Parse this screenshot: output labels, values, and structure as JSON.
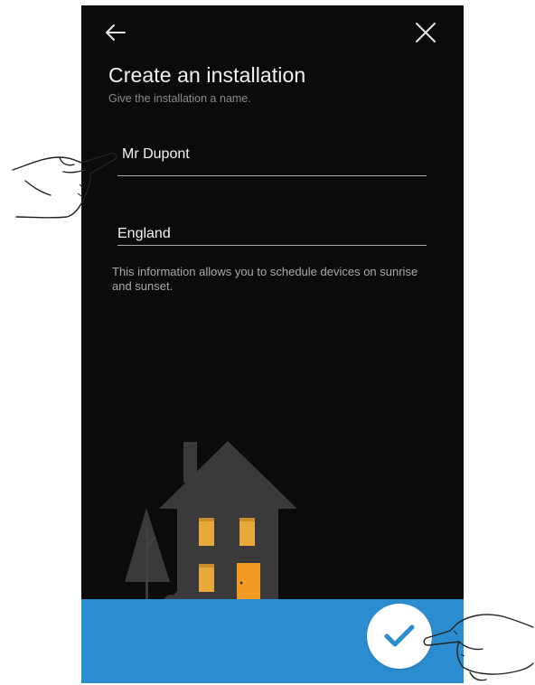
{
  "header": {
    "title": "Create an installation",
    "subtitle": "Give the installation a name."
  },
  "form": {
    "name_value": "Mr Dupont",
    "location_value": "England",
    "info_text": "This information allows you to schedule devices on sunrise and sunset."
  },
  "icons": {
    "back": "arrow-left-icon",
    "close": "close-icon",
    "confirm": "checkmark-icon"
  },
  "colors": {
    "background": "#0b0b0b",
    "bottom_bar": "#2b8dd0",
    "window_light": "#e8a93a",
    "door": "#f29a23"
  }
}
